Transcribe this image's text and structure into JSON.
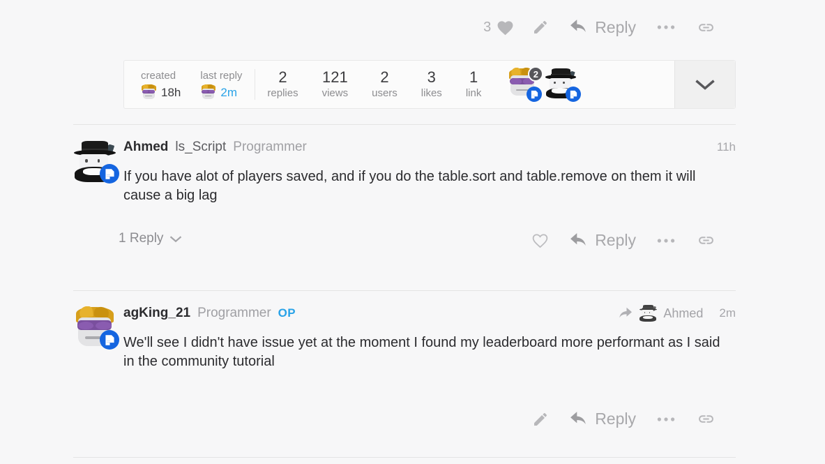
{
  "topbar": {
    "like_count": "3",
    "like_icon": "heart-filled-icon",
    "edit_icon": "pencil-icon",
    "reply_label": "Reply",
    "reply_icon": "reply-arrow-icon",
    "more_icon": "ellipsis-icon",
    "link_icon": "link-icon"
  },
  "stats": {
    "created": {
      "label": "created",
      "value": "18h",
      "avatar": "blonde-sunglasses-avatar"
    },
    "last_reply": {
      "label": "last reply",
      "value": "2m",
      "avatar": "blonde-sunglasses-avatar",
      "color": "#2aa3e8"
    },
    "counts": [
      {
        "value": "2",
        "label": "replies"
      },
      {
        "value": "121",
        "label": "views"
      },
      {
        "value": "2",
        "label": "users"
      },
      {
        "value": "3",
        "label": "likes"
      },
      {
        "value": "1",
        "label": "link"
      }
    ],
    "participants": [
      {
        "avatar": "blonde-sunglasses-avatar",
        "count_badge": "2",
        "doc_badge": true
      },
      {
        "avatar": "black-fedora-avatar",
        "doc_badge": true
      }
    ],
    "expand_icon": "chevron-down-icon"
  },
  "posts": [
    {
      "avatar": "black-fedora-avatar",
      "username": "Ahmed",
      "user_title": "ls_Script",
      "user_group": "Programmer",
      "timestamp": "11h",
      "text": "If you have alot of players saved, and if you do the table.sort and table.remove on them it will cause a big lag",
      "replies_toggle": "1 Reply",
      "replies_toggle_icon": "chevron-down-icon",
      "actions": {
        "like_icon": "heart-outline-icon",
        "reply_label": "Reply",
        "reply_icon": "reply-arrow-icon",
        "more_icon": "ellipsis-icon",
        "link_icon": "link-icon"
      }
    },
    {
      "avatar": "blonde-sunglasses-avatar",
      "username": "agKing_21",
      "user_group": "Programmer",
      "op_badge": "OP",
      "reply_to_icon": "reply-forward-arrow-icon",
      "reply_to_avatar": "black-fedora-avatar",
      "reply_to_name": "Ahmed",
      "timestamp": "2m",
      "text": "We'll see I didn't have issue yet at the moment I found my leaderboard more performant as I said in the community tutorial",
      "actions": {
        "edit_icon": "pencil-icon",
        "reply_label": "Reply",
        "reply_icon": "reply-arrow-icon",
        "more_icon": "ellipsis-icon",
        "link_icon": "link-icon"
      }
    }
  ],
  "colors": {
    "background": "#f7f7f8",
    "accent_blue": "#2aa3e8",
    "badge_blue": "#1565e0",
    "muted": "#a6a6aa",
    "divider": "#e4e4e4"
  }
}
